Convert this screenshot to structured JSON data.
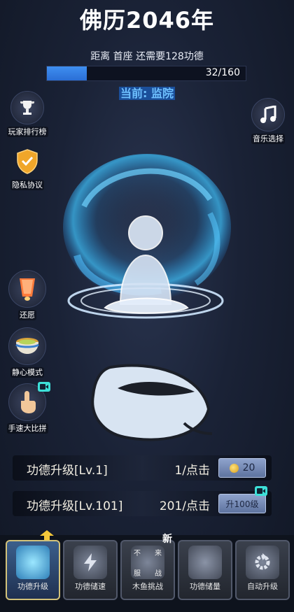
{
  "header": {
    "title": "佛历2046年",
    "goal_text": "距离 首座 还需要128功德",
    "progress_text": "32/160",
    "progress_fraction": 0.2,
    "current_rank": "当前: 监院"
  },
  "left_menu": {
    "leaderboard": "玩家排行榜",
    "privacy": "隐私协议",
    "wish": "还愿",
    "calm_mode": "静心模式",
    "speed_contest": "手速大比拼"
  },
  "right_menu": {
    "music": "音乐选择"
  },
  "upgrades": [
    {
      "name": "功德升级[Lv.1]",
      "rate": "1/点击",
      "button": "20"
    },
    {
      "name": "功德升级[Lv.101]",
      "rate": "201/点击",
      "button": "升100级"
    }
  ],
  "bottom_tabs": [
    {
      "label": "功德升级"
    },
    {
      "label": "功德储速"
    },
    {
      "label": "木鱼挑战",
      "chars": [
        "不",
        "来",
        "服",
        "战"
      ]
    },
    {
      "label": "功德储量"
    },
    {
      "label": "自动升级"
    }
  ],
  "new_badge": "新",
  "colors": {
    "accent_blue": "#3f8ff0",
    "rank_blue": "#6ec0ff",
    "background": "#1a2236"
  }
}
